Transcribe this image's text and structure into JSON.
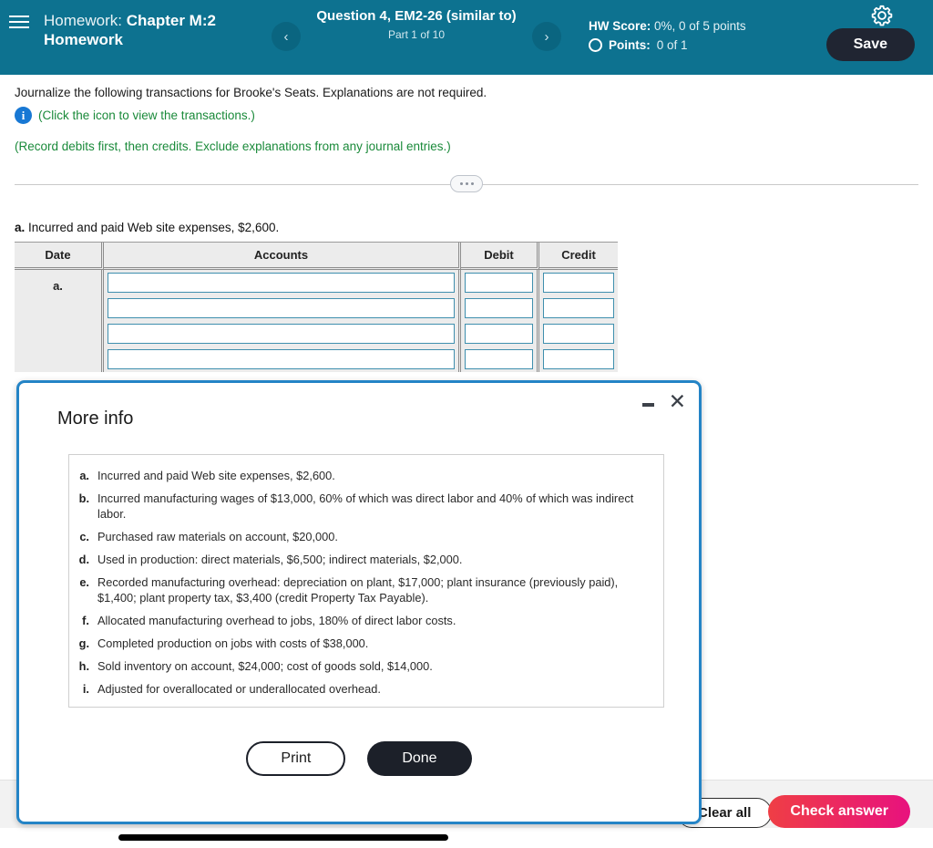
{
  "header": {
    "menu_icon": "hamburger-icon",
    "homework_prefix": "Homework:",
    "homework_name": "Chapter M:2 Homework",
    "prev_label": "‹",
    "next_label": "›",
    "question_title": "Question 4, EM2-26 (similar to)",
    "part_label": "Part 1 of 10",
    "hw_score_label": "HW Score:",
    "hw_score_value": "0%, 0 of 5 points",
    "points_label": "Points:",
    "points_value": "0 of 1",
    "gear_icon": "gear-icon",
    "save_label": "Save",
    "bar_color": "#0d7290",
    "save_color": "#202532"
  },
  "question": {
    "prompt": "Journalize the following transactions for Brooke's Seats. Explanations are not required.",
    "icon_hint": "(Click the icon to view the transactions.)",
    "record_note": "(Record debits first, then credits. Exclude explanations from any journal entries.)",
    "green_color": "#1a8a3a",
    "sub_letter": "a.",
    "sub_text": "Incurred and paid Web site expenses, $2,600."
  },
  "journal_table": {
    "columns": [
      "Date",
      "Accounts",
      "Debit",
      "Credit"
    ],
    "row_label": "a.",
    "rows": [
      {
        "accounts": "",
        "debit": "",
        "credit": ""
      },
      {
        "accounts": "",
        "debit": "",
        "credit": ""
      },
      {
        "accounts": "",
        "debit": "",
        "credit": ""
      },
      {
        "accounts": "",
        "debit": "",
        "credit": ""
      }
    ]
  },
  "modal": {
    "title": "More info",
    "minimize_icon": "minimize-icon",
    "close_icon": "close-icon",
    "border_color": "#2484c6",
    "items": [
      {
        "letter": "a.",
        "text": "Incurred and paid Web site expenses, $2,600."
      },
      {
        "letter": "b.",
        "text": "Incurred manufacturing wages of $13,000, 60% of which was direct labor and 40% of which was indirect labor."
      },
      {
        "letter": "c.",
        "text": "Purchased raw materials on account, $20,000."
      },
      {
        "letter": "d.",
        "text": "Used in production: direct materials, $6,500; indirect materials, $2,000."
      },
      {
        "letter": "e.",
        "text": "Recorded manufacturing overhead: depreciation on plant, $17,000; plant insurance (previously paid), $1,400; plant property tax, $3,400 (credit Property Tax Payable)."
      },
      {
        "letter": "f.",
        "text": "Allocated manufacturing overhead to jobs, 180% of direct labor costs."
      },
      {
        "letter": "g.",
        "text": "Completed production on jobs with costs of $38,000."
      },
      {
        "letter": "h.",
        "text": "Sold inventory on account, $24,000; cost of goods sold, $14,000."
      },
      {
        "letter": "i.",
        "text": "Adjusted for overallocated or underallocated overhead."
      }
    ],
    "print_label": "Print",
    "done_label": "Done"
  },
  "footer": {
    "clear_all_label": "Clear all",
    "check_answer_label": "Check answer",
    "check_color": "#e8127e"
  }
}
